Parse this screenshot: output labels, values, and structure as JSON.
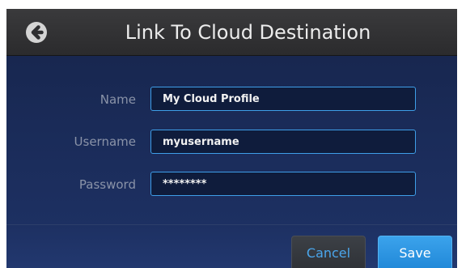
{
  "header": {
    "title": "Link To Cloud Destination",
    "back_icon": "back-arrow-circle-icon"
  },
  "form": {
    "name": {
      "label": "Name",
      "value": "My Cloud Profile"
    },
    "username": {
      "label": "Username",
      "value": "myusername"
    },
    "password": {
      "label": "Password",
      "value": "********"
    }
  },
  "footer": {
    "cancel_label": "Cancel",
    "save_label": "Save"
  },
  "colors": {
    "accent": "#3e9ee8",
    "background": "#1a2b58",
    "header": "#333335",
    "save_button": "#2d96e2"
  }
}
